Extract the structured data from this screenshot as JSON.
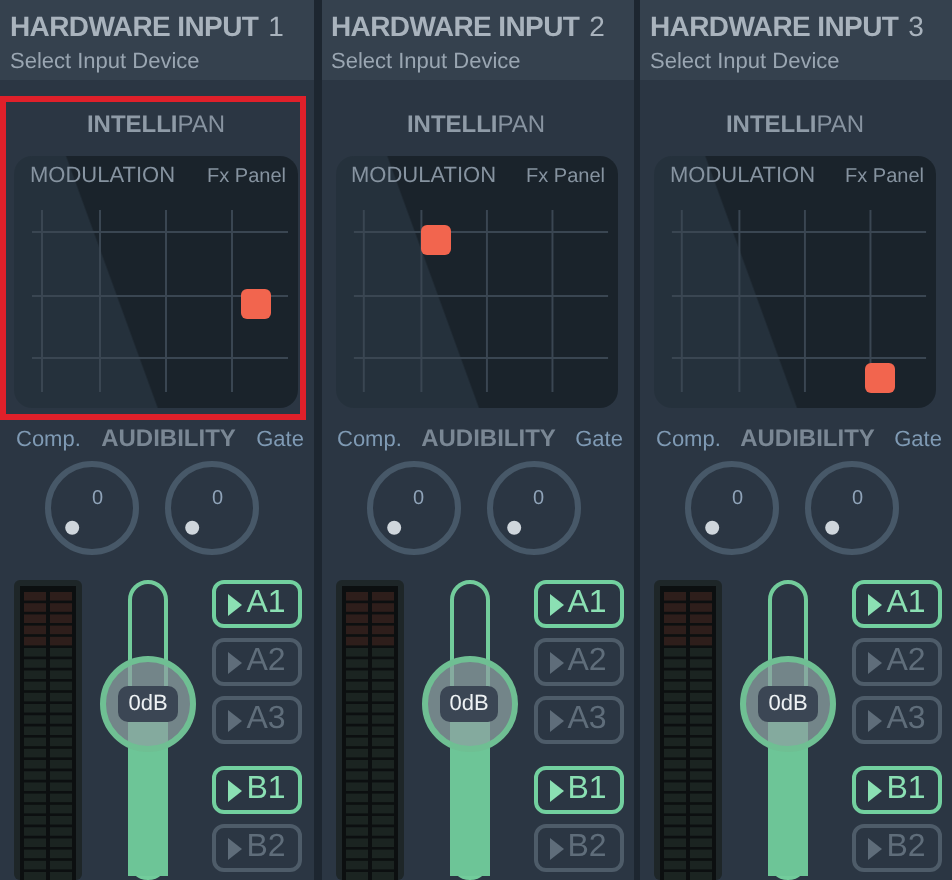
{
  "strips": [
    {
      "title": "HARDWARE INPUT",
      "number": "1",
      "subtitle": "Select Input Device",
      "highlighted": true,
      "intellipan": "**INTELLI**PAN",
      "pad": {
        "mode": "MODULATION",
        "panel": "Fx Panel",
        "x": {
          "level": 0.85
        },
        "y": {
          "level": 0.41
        }
      },
      "audibility": {
        "left": "Comp.",
        "title": "AUDIBILITY",
        "right": "Gate"
      },
      "knobs": [
        {
          "value": "0",
          "level": 0
        },
        {
          "value": "0",
          "level": 0
        }
      ],
      "fader": {
        "label": "0dB",
        "level": 0.59
      },
      "buses": [
        {
          "label": "A1",
          "on": true
        },
        {
          "label": "A2",
          "on": false
        },
        {
          "label": "A3",
          "on": false
        },
        {
          "label": "B1",
          "on": true
        },
        {
          "label": "B2",
          "on": false
        }
      ]
    },
    {
      "title": "HARDWARE INPUT",
      "number": "2",
      "subtitle": "Select Input Device",
      "highlighted": false,
      "intellipan": "**INTELLI**PAN",
      "pad": {
        "mode": "MODULATION",
        "panel": "Fx Panel",
        "x": {
          "level": 0.36
        },
        "y": {
          "level": 0.67
        }
      },
      "audibility": {
        "left": "Comp.",
        "title": "AUDIBILITY",
        "right": "Gate"
      },
      "knobs": [
        {
          "value": "0",
          "level": 0
        },
        {
          "value": "0",
          "level": 0
        }
      ],
      "fader": {
        "label": "0dB",
        "level": 0.59
      },
      "buses": [
        {
          "label": "A1",
          "on": true
        },
        {
          "label": "A2",
          "on": false
        },
        {
          "label": "A3",
          "on": false
        },
        {
          "label": "B1",
          "on": true
        },
        {
          "label": "B2",
          "on": false
        }
      ]
    },
    {
      "title": "HARDWARE INPUT",
      "number": "3",
      "subtitle": "Select Input Device",
      "highlighted": false,
      "intellipan": "**INTELLI**PAN",
      "pad": {
        "mode": "MODULATION",
        "panel": "Fx Panel",
        "x": {
          "level": 0.8
        },
        "y": {
          "level": 0.12
        }
      },
      "audibility": {
        "left": "Comp.",
        "title": "AUDIBILITY",
        "right": "Gate"
      },
      "knobs": [
        {
          "value": "0",
          "level": 0
        },
        {
          "value": "0",
          "level": 0
        }
      ],
      "fader": {
        "label": "0dB",
        "level": 0.59
      },
      "buses": [
        {
          "label": "A1",
          "on": true
        },
        {
          "label": "A2",
          "on": false
        },
        {
          "label": "A3",
          "on": false
        },
        {
          "label": "B1",
          "on": true
        },
        {
          "label": "B2",
          "on": false
        }
      ]
    }
  ]
}
